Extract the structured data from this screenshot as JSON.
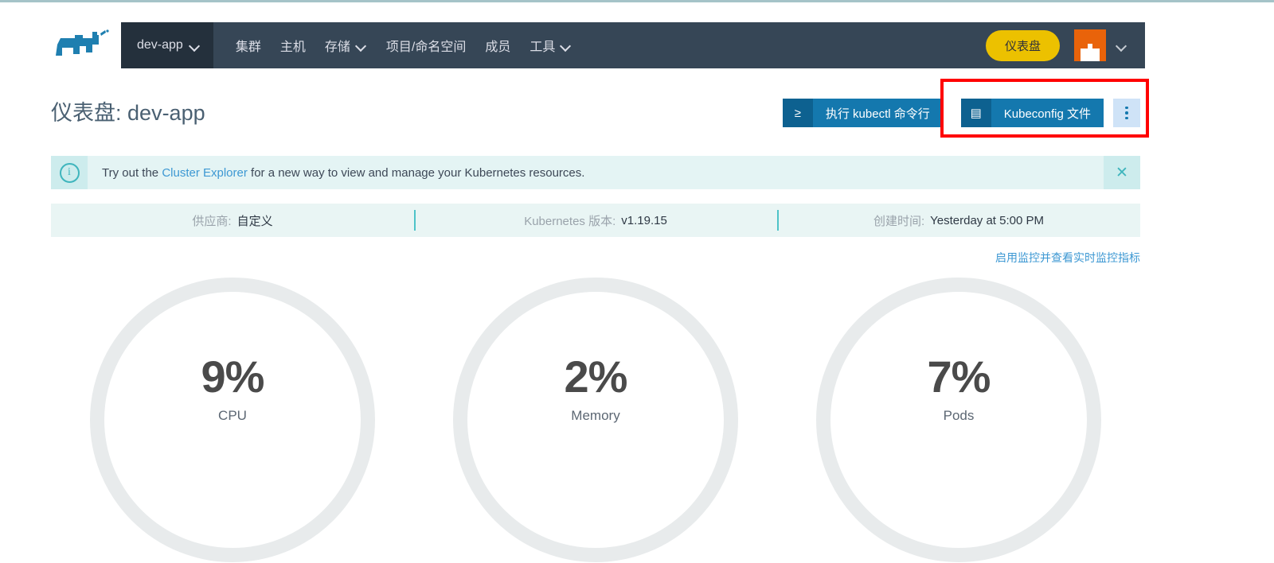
{
  "header": {
    "logo_icon": "rancher-cow-logo",
    "cluster_switcher": {
      "label": "dev-app",
      "caret_icon": "chevron-down-icon"
    },
    "nav_items": [
      {
        "label": "集群",
        "has_caret": false
      },
      {
        "label": "主机",
        "has_caret": false
      },
      {
        "label": "存储",
        "has_caret": true
      },
      {
        "label": "项目/命名空间",
        "has_caret": false
      },
      {
        "label": "成员",
        "has_caret": false
      },
      {
        "label": "工具",
        "has_caret": true
      }
    ],
    "dashboard_button": "仪表盘",
    "avatar_icon": "user-avatar-icon",
    "avatar_caret_icon": "chevron-down-icon",
    "colors": {
      "nav_bg": "#364656",
      "cluster_bg": "#24303c",
      "dashboard_pill": "#ecc100",
      "avatar_bg": "#e9630a"
    }
  },
  "page": {
    "title_label": "仪表盘:",
    "title_value": "dev-app"
  },
  "actions": {
    "kubectl": {
      "label": "执行 kubectl 命令行",
      "icon": "terminal-prompt-icon",
      "icon_glyph": "≥"
    },
    "kubeconfig": {
      "label": "Kubeconfig 文件",
      "icon": "document-file-icon",
      "icon_glyph": "▤"
    },
    "kebab": {
      "icon": "kebab-menu-icon"
    },
    "annotation_color": "#ff0000"
  },
  "banner": {
    "icon": "info-circle-icon",
    "icon_glyph": "i",
    "text_before": "Try out the ",
    "link_text": "Cluster Explorer",
    "text_after": " for a new way to view and manage your Kubernetes resources.",
    "close_icon": "close-icon",
    "close_glyph": "✕",
    "link_color": "#3d98d3"
  },
  "meta": [
    {
      "label": "供应商:",
      "value": "自定义"
    },
    {
      "label": "Kubernetes 版本:",
      "value": "v1.19.15"
    },
    {
      "label": "创建时间:",
      "value": "Yesterday at 5:00 PM"
    }
  ],
  "monitoring_link": "启用监控并查看实时监控指标",
  "chart_data": {
    "type": "gauge",
    "title": "",
    "ring_color": "#e8ebec",
    "ring_stroke_px": 18,
    "ylim": [
      0,
      100
    ],
    "gauges": [
      {
        "label": "CPU",
        "value": 9,
        "display": "9%"
      },
      {
        "label": "Memory",
        "value": 2,
        "display": "2%"
      },
      {
        "label": "Pods",
        "value": 7,
        "display": "7%"
      }
    ]
  }
}
